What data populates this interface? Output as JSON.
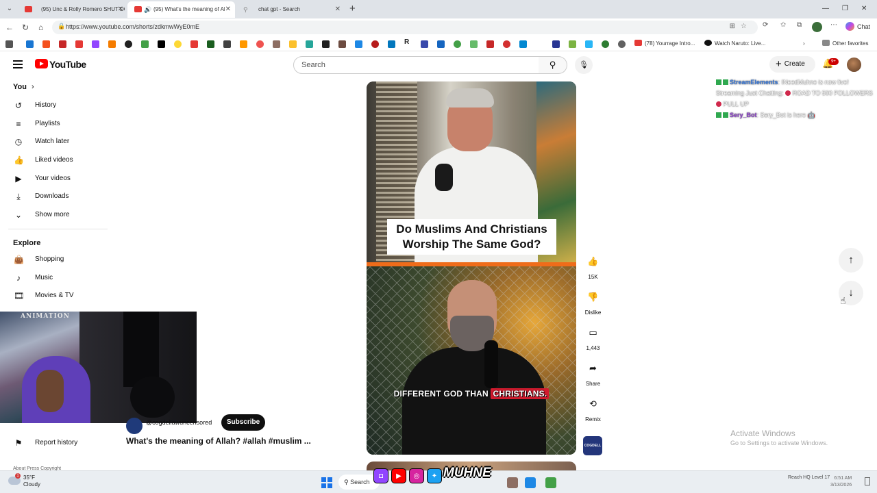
{
  "browser": {
    "tabs": [
      {
        "title": "(95) Unc & Rolly Romero SHUT DO",
        "active": false
      },
      {
        "title": "(95) What's the meaning of Al",
        "active": true
      },
      {
        "title": "chat gpt - Search",
        "active": false
      }
    ],
    "url": "https://www.youtube.com/shorts/zdkmwWyE0mE",
    "copilot_label": "Chat",
    "favorites": [
      {
        "label": "(78) Yourrage Intro..."
      },
      {
        "label": "Watch Naruto: Live..."
      }
    ],
    "other_favorites": "Other favorites",
    "fav_r": "R"
  },
  "youtube": {
    "logo_text": "YouTube",
    "search_placeholder": "Search",
    "create_label": "Create",
    "notification_count": "9+"
  },
  "guide": {
    "you_label": "You",
    "you_items": [
      {
        "label": "History",
        "icon": "history-icon",
        "glyph": "↺"
      },
      {
        "label": "Playlists",
        "icon": "playlists-icon",
        "glyph": "≡"
      },
      {
        "label": "Watch later",
        "icon": "clock-icon",
        "glyph": "◷"
      },
      {
        "label": "Liked videos",
        "icon": "thumbs-up-icon",
        "glyph": "👍"
      },
      {
        "label": "Your videos",
        "icon": "video-icon",
        "glyph": "▶"
      },
      {
        "label": "Downloads",
        "icon": "download-icon",
        "glyph": "⤓"
      },
      {
        "label": "Show more",
        "icon": "chevron-down-icon",
        "glyph": "⌄"
      }
    ],
    "explore_label": "Explore",
    "explore_items": [
      {
        "label": "Shopping",
        "icon": "shopping-bag-icon",
        "glyph": "👜"
      },
      {
        "label": "Music",
        "icon": "music-icon",
        "glyph": "♪"
      },
      {
        "label": "Movies & TV",
        "icon": "film-icon",
        "glyph": "🎞"
      }
    ],
    "report_history": "Report history",
    "footer": "About  Press  Copyright"
  },
  "short": {
    "caption_top": "Do Muslims And Christians Worship The Same God?",
    "caption_bottom_plain": "DIFFERENT GOD THAN",
    "caption_bottom_highlight": "CHRISTIANS.",
    "channel_handle": "@cogdellawuncensored",
    "subscribe_label": "Subscribe",
    "title": "What's the meaning of Allah? #allah #muslim ..."
  },
  "actions": {
    "like_count": "15K",
    "dislike_label": "Dislike",
    "comment_count": "1,443",
    "share_label": "Share",
    "remix_label": "Remix",
    "channel_thumb_text": "COGDELL"
  },
  "chat": {
    "messages": [
      {
        "user": "StreamElements",
        "text": "INeedMuhne is now live! Streaming Just Chatting:",
        "text2": "ROAD TO 500 FOLLOWERS",
        "text3": "PULL UP"
      },
      {
        "user": "Sery_Bot",
        "text": "Sery_Bot is here"
      }
    ]
  },
  "webcam": {
    "poster_text": "ANIMATION"
  },
  "watermark": {
    "title": "Activate Windows",
    "subtitle": "Go to Settings to activate Windows."
  },
  "overlay_brand": "MUHNE",
  "taskbar": {
    "temperature": "35°F",
    "condition": "Cloudy",
    "weather_alert": "1",
    "search_label": "Search",
    "tray_text": "Reach HQ Level 17",
    "clock_time": "6:51 AM",
    "clock_date": "3/13/2026"
  },
  "colors": {
    "youtube_red": "#ff0000",
    "accent_orange": "#ef6c1a",
    "caption_highlight": "#d21b2e",
    "streamelements_blue": "#3a79d9",
    "serybot_purple": "#8a3ec9"
  }
}
